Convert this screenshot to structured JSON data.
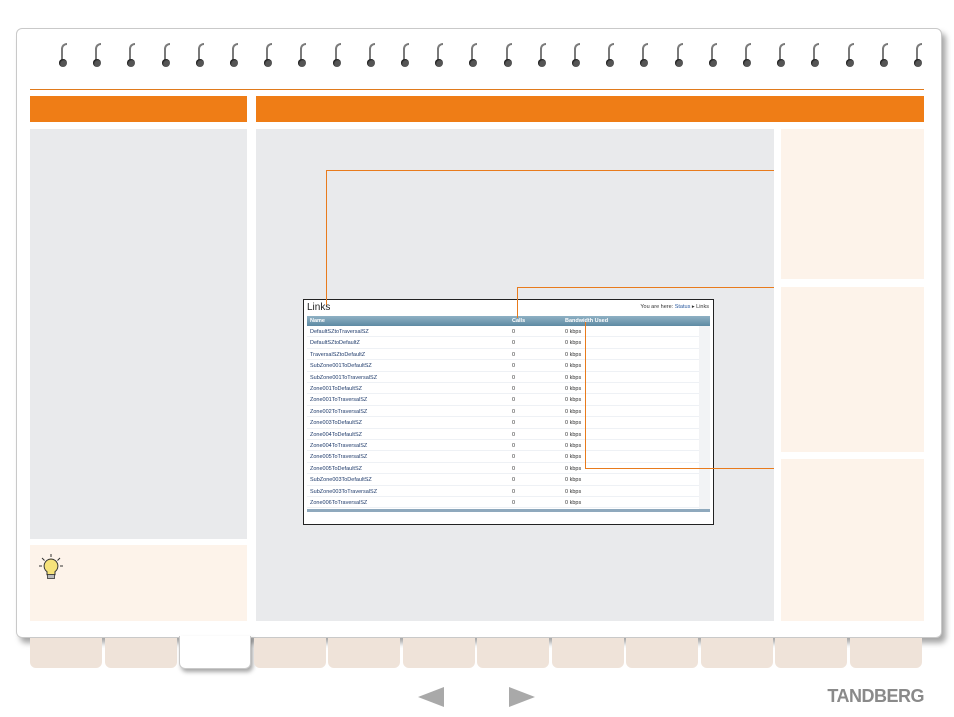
{
  "links_window": {
    "title": "Links",
    "breadcrumb": {
      "prefix": "You are here:",
      "status_link": "Status",
      "separator": "▸",
      "current": "Links"
    },
    "columns": [
      "Name",
      "Calls",
      "Bandwidth Used"
    ],
    "rows": [
      {
        "name": "DefaultSZtoTraversalSZ",
        "calls": "0",
        "bandwidth": "0 kbps"
      },
      {
        "name": "DefaultSZtoDefaultZ",
        "calls": "0",
        "bandwidth": "0 kbps"
      },
      {
        "name": "TraversalSZtoDefaultZ",
        "calls": "0",
        "bandwidth": "0 kbps"
      },
      {
        "name": "SubZone001ToDefaultSZ",
        "calls": "0",
        "bandwidth": "0 kbps"
      },
      {
        "name": "SubZone001ToTraversalSZ",
        "calls": "0",
        "bandwidth": "0 kbps"
      },
      {
        "name": "Zone001ToDefaultSZ",
        "calls": "0",
        "bandwidth": "0 kbps"
      },
      {
        "name": "Zone001ToTraversalSZ",
        "calls": "0",
        "bandwidth": "0 kbps"
      },
      {
        "name": "Zone002ToTraversalSZ",
        "calls": "0",
        "bandwidth": "0 kbps"
      },
      {
        "name": "Zone003ToDefaultSZ",
        "calls": "0",
        "bandwidth": "0 kbps"
      },
      {
        "name": "Zone004ToDefaultSZ",
        "calls": "0",
        "bandwidth": "0 kbps"
      },
      {
        "name": "Zone004ToTraversalSZ",
        "calls": "0",
        "bandwidth": "0 kbps"
      },
      {
        "name": "Zone005ToTraversalSZ",
        "calls": "0",
        "bandwidth": "0 kbps"
      },
      {
        "name": "Zone005ToDefaultSZ",
        "calls": "0",
        "bandwidth": "0 kbps"
      },
      {
        "name": "SubZone003ToDefaultSZ",
        "calls": "0",
        "bandwidth": "0 kbps"
      },
      {
        "name": "SubZone003ToTraversalSZ",
        "calls": "0",
        "bandwidth": "0 kbps"
      },
      {
        "name": "Zone006ToTraversalSZ",
        "calls": "0",
        "bandwidth": "0 kbps"
      }
    ]
  },
  "footer": {
    "logo_text": "TANDBERG"
  },
  "icons": {
    "tip": "lightbulb-icon",
    "prev": "previous-arrow-icon",
    "next": "next-arrow-icon"
  },
  "colors": {
    "accent": "#ef7d16",
    "panel": "#e9eaec",
    "side_panel": "#fdf3ea",
    "table_header": "#6f97ad"
  },
  "tabs": {
    "count": 12,
    "active_index": 2
  }
}
